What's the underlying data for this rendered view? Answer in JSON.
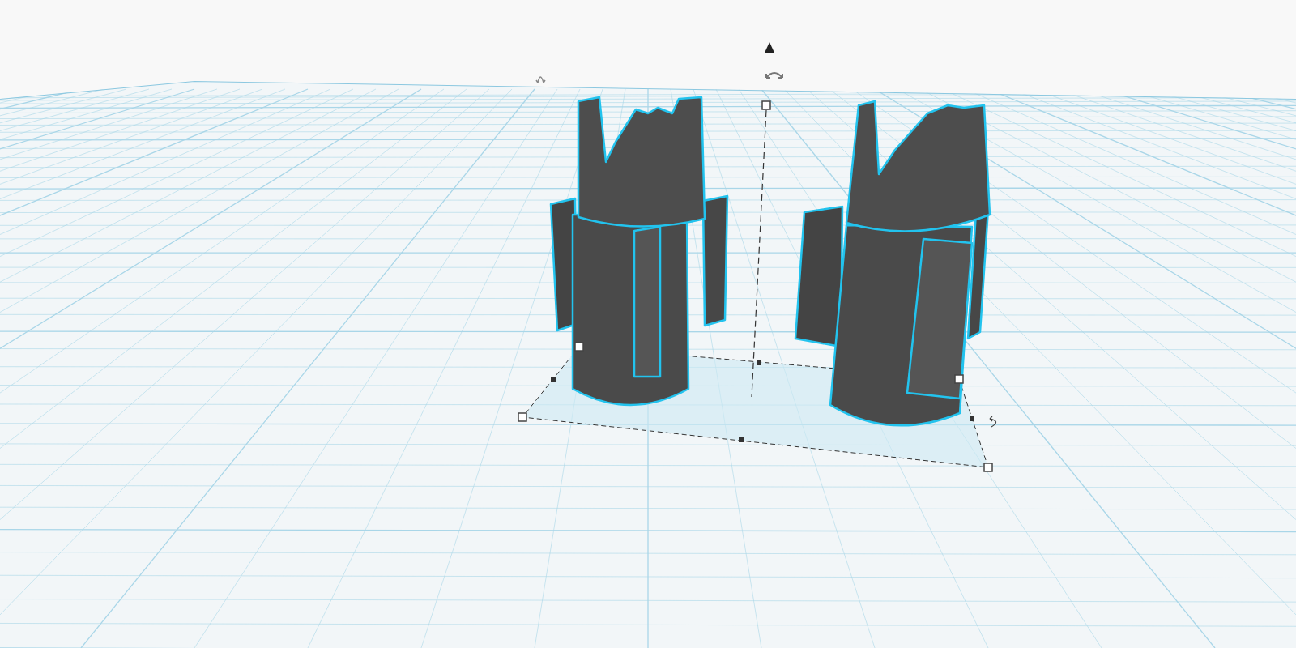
{
  "shapes": [
    {
      "selected": true
    },
    {
      "selected": true
    }
  ]
}
